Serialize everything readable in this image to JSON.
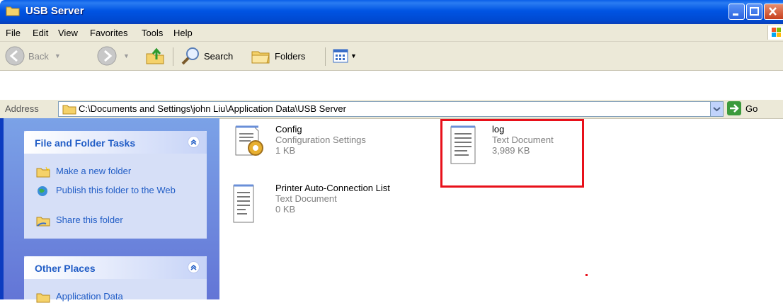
{
  "window": {
    "title": "USB Server"
  },
  "menu": [
    "File",
    "Edit",
    "View",
    "Favorites",
    "Tools",
    "Help"
  ],
  "toolbar": {
    "back": "Back",
    "search": "Search",
    "folders": "Folders"
  },
  "address": {
    "label": "Address",
    "path": "C:\\Documents and Settings\\john Liu\\Application Data\\USB Server",
    "go": "Go"
  },
  "tasks": {
    "title": "File and Folder Tasks",
    "items": [
      "Make a new folder",
      "Publish this folder to the Web",
      "Share this folder"
    ]
  },
  "other_places": {
    "title": "Other Places",
    "items": [
      "Application Data"
    ]
  },
  "files": [
    {
      "name": "Config",
      "type": "Configuration Settings",
      "size": "1 KB"
    },
    {
      "name": "log",
      "type": "Text Document",
      "size": "3,989 KB"
    },
    {
      "name": "Printer Auto-Connection List",
      "type": "Text Document",
      "size": "0 KB"
    }
  ],
  "colors": {
    "titlebar": "#0054e3",
    "task_link": "#215dc6",
    "highlight": "#e8101a"
  }
}
